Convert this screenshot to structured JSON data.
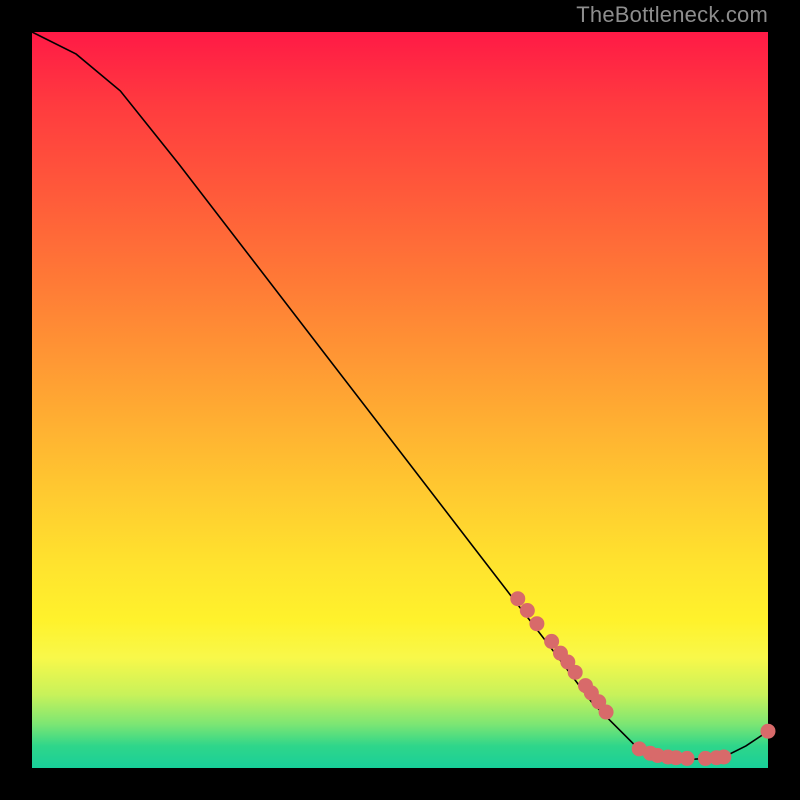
{
  "watermark": "TheBottleneck.com",
  "chart_data": {
    "type": "line",
    "title": "",
    "xlabel": "",
    "ylabel": "",
    "xlim": [
      0,
      100
    ],
    "ylim": [
      0,
      100
    ],
    "line": [
      {
        "x": 0,
        "y": 100
      },
      {
        "x": 6,
        "y": 97
      },
      {
        "x": 12,
        "y": 92
      },
      {
        "x": 20,
        "y": 82
      },
      {
        "x": 30,
        "y": 69
      },
      {
        "x": 40,
        "y": 56
      },
      {
        "x": 50,
        "y": 43
      },
      {
        "x": 60,
        "y": 30
      },
      {
        "x": 70,
        "y": 17
      },
      {
        "x": 76,
        "y": 9
      },
      {
        "x": 82,
        "y": 3
      },
      {
        "x": 86,
        "y": 1.5
      },
      {
        "x": 90,
        "y": 1.2
      },
      {
        "x": 94,
        "y": 1.5
      },
      {
        "x": 97,
        "y": 3
      },
      {
        "x": 100,
        "y": 5
      }
    ],
    "scatter_groups": [
      {
        "name": "cluster-upper",
        "points": [
          {
            "x": 66,
            "y": 23
          },
          {
            "x": 67.3,
            "y": 21.4
          },
          {
            "x": 68.6,
            "y": 19.6
          },
          {
            "x": 70.6,
            "y": 17.2
          },
          {
            "x": 71.8,
            "y": 15.6
          },
          {
            "x": 72.8,
            "y": 14.4
          },
          {
            "x": 73.8,
            "y": 13.0
          },
          {
            "x": 75.2,
            "y": 11.2
          },
          {
            "x": 76.0,
            "y": 10.2
          },
          {
            "x": 77.0,
            "y": 9.0
          },
          {
            "x": 78.0,
            "y": 7.6
          }
        ]
      },
      {
        "name": "cluster-lower",
        "points": [
          {
            "x": 82.5,
            "y": 2.6
          },
          {
            "x": 84.0,
            "y": 2.0
          },
          {
            "x": 85.0,
            "y": 1.7
          },
          {
            "x": 86.4,
            "y": 1.5
          },
          {
            "x": 87.5,
            "y": 1.4
          },
          {
            "x": 89.0,
            "y": 1.3
          },
          {
            "x": 91.5,
            "y": 1.3
          },
          {
            "x": 93.0,
            "y": 1.4
          },
          {
            "x": 94.0,
            "y": 1.5
          }
        ]
      },
      {
        "name": "point-end",
        "points": [
          {
            "x": 100,
            "y": 5
          }
        ]
      }
    ],
    "style": {
      "line_color": "#000000",
      "line_width": 1.6,
      "marker_fill": "#d86a6a",
      "marker_stroke": "#d86a6a",
      "marker_radius": 7
    }
  }
}
